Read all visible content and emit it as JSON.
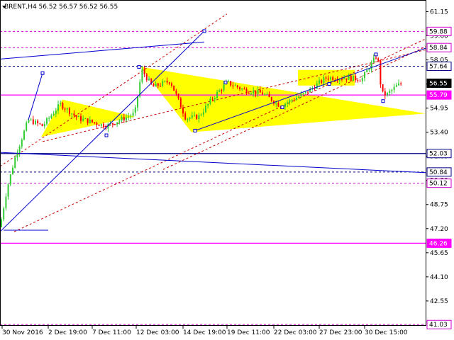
{
  "chart_data": {
    "type": "candlestick",
    "title": "BRENT,H4  56.52 56.57 56.52 56.55",
    "symbol": "BRENT",
    "timeframe": "H4",
    "last_bar": {
      "open": 56.52,
      "high": 56.57,
      "low": 56.52,
      "close": 56.55
    },
    "ylim": [
      40.95,
      61.9
    ],
    "y_ticks": [
      61.15,
      59.6,
      58.05,
      56.5,
      54.95,
      53.4,
      51.85,
      50.3,
      48.75,
      47.2,
      45.65,
      44.1,
      42.55
    ],
    "x_tick_labels": [
      "30 Nov 2016",
      "2 Dec 19:00",
      "7 Dec 11:00",
      "12 Dec 03:00",
      "14 Dec 19:00",
      "19 Dec 11:00",
      "22 Dec 03:00",
      "27 Dec 23:00",
      "30 Dec 15:00"
    ],
    "levels": [
      {
        "value": 59.88,
        "label": "59.88",
        "color": "#cc00cc",
        "style": "dashed",
        "badge": true
      },
      {
        "value": 58.84,
        "label": "58.84",
        "color": "#cc00cc",
        "style": "dashed",
        "badge": true
      },
      {
        "value": 57.64,
        "label": "57.64",
        "color": "#000080",
        "style": "dashed",
        "badge": true
      },
      {
        "value": 56.55,
        "label": "56.55",
        "color": "#000000",
        "style": "none",
        "badge": true
      },
      {
        "value": 55.79,
        "label": "55.79",
        "color": "#ff00ff",
        "style": "solid",
        "badge": true
      },
      {
        "value": 52.03,
        "label": "52.03",
        "color": "#000080",
        "style": "solid",
        "badge": true
      },
      {
        "value": 50.84,
        "label": "50.84",
        "color": "#000080",
        "style": "dashed",
        "badge": true
      },
      {
        "value": 50.12,
        "label": "50.12",
        "color": "#cc00cc",
        "style": "dashed",
        "badge": true
      },
      {
        "value": 46.26,
        "label": "46.26",
        "color": "#ff00ff",
        "style": "solid",
        "badge": true
      },
      {
        "value": 41.03,
        "label": "41.03",
        "color": "#cc00cc",
        "style": "dashed",
        "badge": true
      }
    ],
    "colors": {
      "bull": "#32cd32",
      "bear": "#ff0000",
      "pattern": "#ffff00",
      "trend": "#0000cc",
      "channel": "#cc0000"
    }
  }
}
